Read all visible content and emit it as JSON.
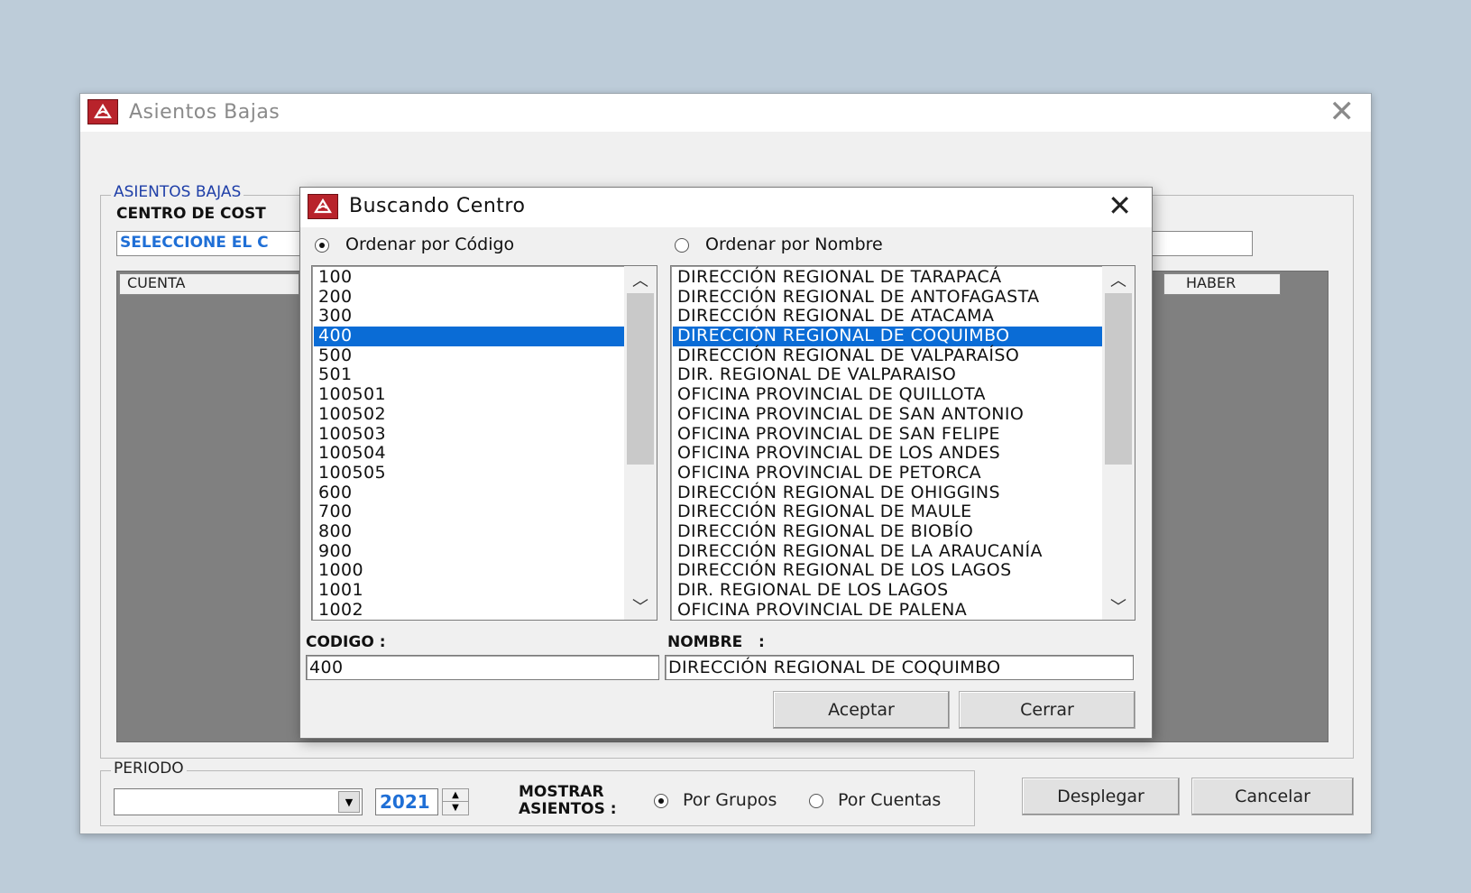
{
  "main_window": {
    "title": "Asientos Bajas",
    "group_asientos_label": "ASIENTOS BAJAS",
    "centro_label": "CENTRO DE COST",
    "seleccione_text": "SELECCIONE EL C",
    "columns": {
      "cuenta": "CUENTA",
      "haber": "HABER"
    },
    "periodo": {
      "label": "PERIODO",
      "month_value": "",
      "year_value": "2021",
      "mostrar_label_1": "MOSTRAR",
      "mostrar_label_2": "ASIENTOS :",
      "options": [
        {
          "label": "Por Grupos",
          "selected": true
        },
        {
          "label": "Por Cuentas",
          "selected": false
        }
      ]
    },
    "buttons": {
      "desplegar": "Desplegar",
      "cancelar": "Cancelar"
    }
  },
  "dialog": {
    "title": "Buscando Centro",
    "sort_options": [
      {
        "label": "Ordenar por Código",
        "selected": true
      },
      {
        "label": "Ordenar por Nombre",
        "selected": false
      }
    ],
    "codes": [
      "100",
      "200",
      "300",
      "400",
      "500",
      "501",
      "100501",
      "100502",
      "100503",
      "100504",
      "100505",
      "600",
      "700",
      "800",
      "900",
      "1000",
      "1001",
      "1002"
    ],
    "names": [
      "DIRECCIÓN REGIONAL DE TARAPACÁ",
      "DIRECCIÓN REGIONAL DE ANTOFAGASTA",
      "DIRECCIÓN REGIONAL DE ATACAMA",
      "DIRECCIÓN REGIONAL DE COQUIMBO",
      "DIRECCIÓN REGIONAL DE VALPARAÍSO",
      "DIR. REGIONAL DE VALPARAISO",
      "OFICINA PROVINCIAL DE QUILLOTA",
      "OFICINA PROVINCIAL DE SAN ANTONIO",
      "OFICINA PROVINCIAL DE SAN FELIPE",
      "OFICINA PROVINCIAL DE LOS ANDES",
      "OFICINA PROVINCIAL DE PETORCA",
      "DIRECCIÓN REGIONAL DE OHIGGINS",
      "DIRECCIÓN REGIONAL DE MAULE",
      "DIRECCIÓN REGIONAL DE BIOBÍO",
      "DIRECCIÓN REGIONAL DE LA ARAUCANÍA",
      "DIRECCIÓN REGIONAL DE LOS LAGOS",
      "DIR. REGIONAL DE LOS LAGOS",
      "OFICINA PROVINCIAL DE PALENA"
    ],
    "selected_index": 3,
    "codigo_label": "CODIGO :",
    "nombre_label": "NOMBRE   :",
    "codigo_value": "400",
    "nombre_value": "DIRECCIÓN REGIONAL DE COQUIMBO",
    "buttons": {
      "aceptar": "Aceptar",
      "cerrar": "Cerrar"
    }
  },
  "colors": {
    "selection": "#0a6cd6",
    "group_label": "#1f3fa8",
    "year_text": "#1f6fd6",
    "app_icon": "#b8232b",
    "desktop": "#bdccd9"
  },
  "icons": {
    "app": "app-logo-icon",
    "close": "close-icon",
    "scroll_up": "chevron-up-icon",
    "scroll_down": "chevron-down-icon",
    "dropdown": "dropdown-arrow-icon",
    "spinner": "spinner-arrows-icon"
  }
}
